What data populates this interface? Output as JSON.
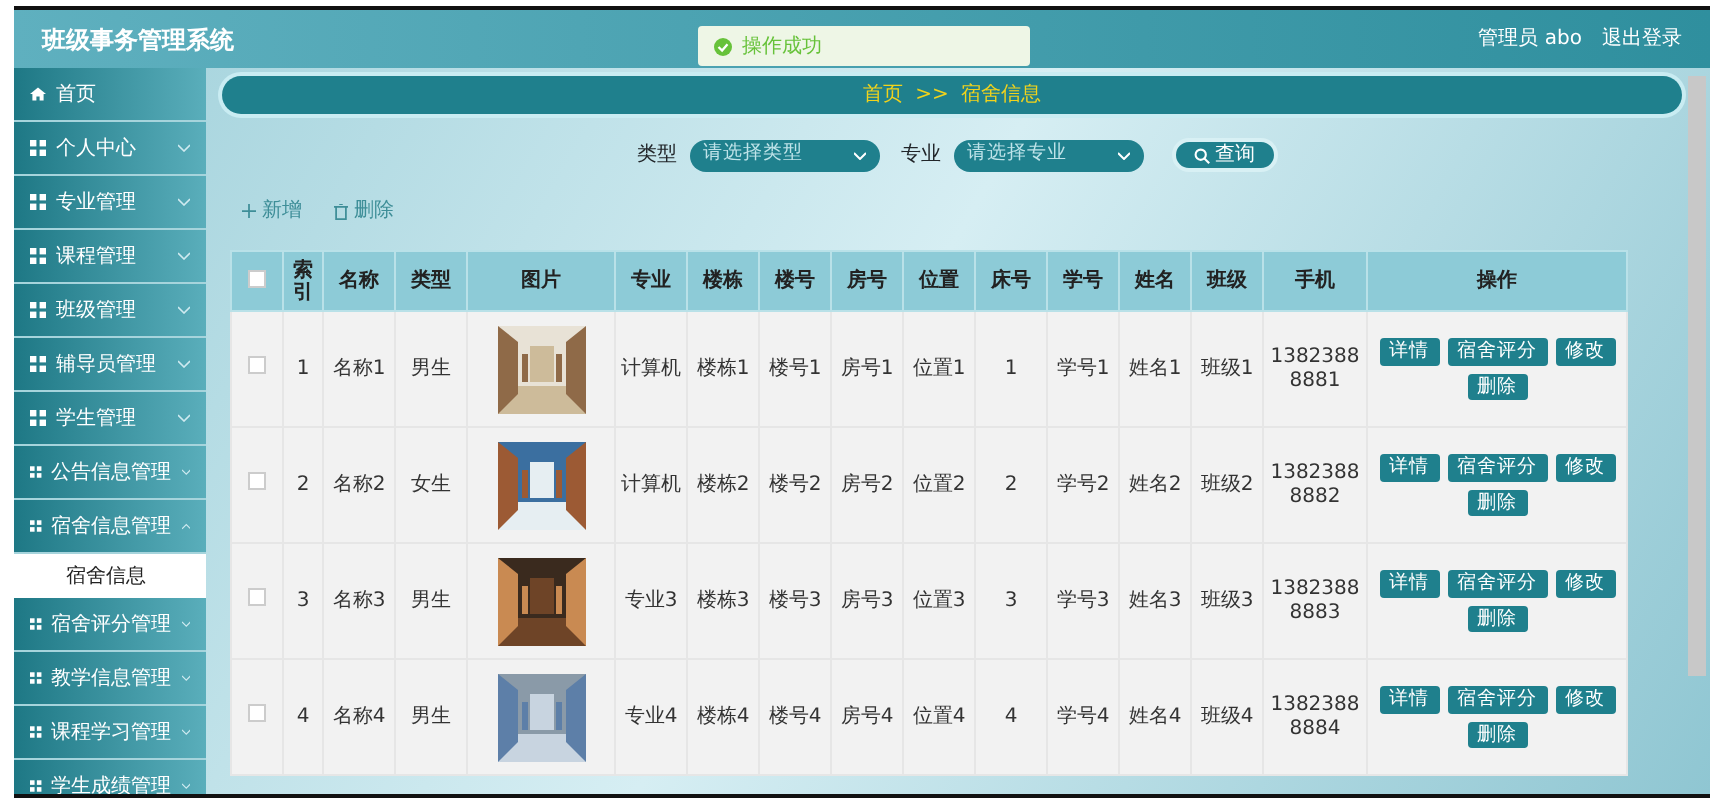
{
  "app": {
    "title": "班级事务管理系统"
  },
  "toast": {
    "text": "操作成功"
  },
  "user": {
    "role": "管理员",
    "name": "abo",
    "logout": "退出登录"
  },
  "sidebar": {
    "items": [
      {
        "label": "首页",
        "kind": "link"
      },
      {
        "label": "个人中心",
        "kind": "menu",
        "expanded": false
      },
      {
        "label": "专业管理",
        "kind": "menu",
        "expanded": false
      },
      {
        "label": "课程管理",
        "kind": "menu",
        "expanded": false
      },
      {
        "label": "班级管理",
        "kind": "menu",
        "expanded": false
      },
      {
        "label": "辅导员管理",
        "kind": "menu",
        "expanded": false
      },
      {
        "label": "学生管理",
        "kind": "menu",
        "expanded": false
      },
      {
        "label": "公告信息管理",
        "kind": "menu",
        "expanded": false
      },
      {
        "label": "宿舍信息管理",
        "kind": "menu",
        "expanded": true,
        "children": [
          {
            "label": "宿舍信息",
            "selected": true
          }
        ]
      },
      {
        "label": "宿舍评分管理",
        "kind": "menu",
        "expanded": false
      },
      {
        "label": "教学信息管理",
        "kind": "menu",
        "expanded": false
      },
      {
        "label": "课程学习管理",
        "kind": "menu",
        "expanded": false
      },
      {
        "label": "学生成绩管理",
        "kind": "menu",
        "expanded": false
      }
    ]
  },
  "breadcrumb": [
    "首页",
    ">>",
    "宿舍信息"
  ],
  "filters": [
    {
      "label": "类型",
      "placeholder": "请选择类型"
    },
    {
      "label": "专业",
      "placeholder": "请选择专业"
    }
  ],
  "search_button": "查询",
  "toolbar": {
    "add": "新增",
    "delete": "删除"
  },
  "table": {
    "columns": [
      "索引",
      "名称",
      "类型",
      "图片",
      "专业",
      "楼栋",
      "楼号",
      "房号",
      "位置",
      "床号",
      "学号",
      "姓名",
      "班级",
      "手机",
      "操作"
    ],
    "select_all": false,
    "rows": [
      {
        "checked": false,
        "cells": [
          "1",
          "名称1",
          "男生",
          null,
          "计算机",
          "楼栋1",
          "楼号1",
          "房号1",
          "位置1",
          "1",
          "学号1",
          "姓名1",
          "班级1",
          "13823888881"
        ],
        "actions": [
          "详情",
          "宿舍评分",
          "修改",
          "删除"
        ]
      },
      {
        "checked": false,
        "cells": [
          "2",
          "名称2",
          "女生",
          null,
          "计算机",
          "楼栋2",
          "楼号2",
          "房号2",
          "位置2",
          "2",
          "学号2",
          "姓名2",
          "班级2",
          "13823888882"
        ],
        "actions": [
          "详情",
          "宿舍评分",
          "修改",
          "删除"
        ]
      },
      {
        "checked": false,
        "cells": [
          "3",
          "名称3",
          "男生",
          null,
          "专业3",
          "楼栋3",
          "楼号3",
          "房号3",
          "位置3",
          "3",
          "学号3",
          "姓名3",
          "班级3",
          "13823888883"
        ],
        "actions": [
          "详情",
          "宿舍评分",
          "修改",
          "删除"
        ]
      },
      {
        "checked": false,
        "cells": [
          "4",
          "名称4",
          "男生",
          null,
          "专业4",
          "楼栋4",
          "楼号4",
          "房号4",
          "位置4",
          "4",
          "学号4",
          "姓名4",
          "班级4",
          "13823888884"
        ],
        "actions": [
          "详情",
          "宿舍评分",
          "修改",
          "删除"
        ]
      }
    ]
  }
}
